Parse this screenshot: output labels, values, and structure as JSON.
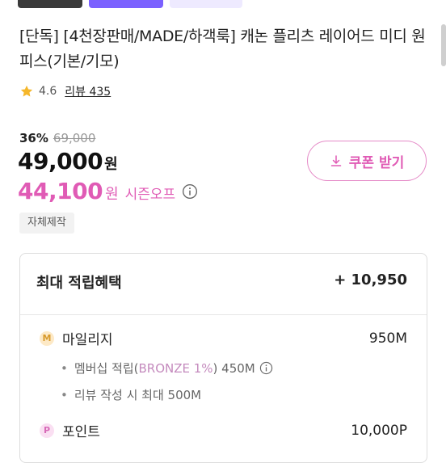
{
  "colors": {
    "accent_pink": "#e05bb5",
    "coupon_border": "#e58ac7",
    "star": "#f5b72b"
  },
  "product": {
    "title": "[단독] [4천장판매/MADE/하객룩] 캐논 플리츠 레이어드 미디 원피스(기본/기모)",
    "rating": "4.6",
    "review_label": "리뷰",
    "review_count": "435"
  },
  "price": {
    "discount_rate": "36%",
    "original_price": "69,000",
    "price": "49,000",
    "price_unit": "원",
    "sale_price": "44,100",
    "sale_unit": "원",
    "sale_label": "시즌오프"
  },
  "coupon": {
    "label": "쿠폰 받기",
    "icon": "download-icon"
  },
  "badge": "자체제작",
  "benefits": {
    "title": "최대 적립혜택",
    "total": "+ 10,950",
    "mileage": {
      "coin": "M",
      "label": "마일리지",
      "value": "950M",
      "sub1_prefix": "멤버십 적립(",
      "sub1_highlight": "BRONZE 1%",
      "sub1_suffix": ") 450M",
      "sub2": "리뷰 작성 시 최대 500M"
    },
    "point": {
      "coin": "P",
      "label": "포인트",
      "value": "10,000P"
    }
  }
}
